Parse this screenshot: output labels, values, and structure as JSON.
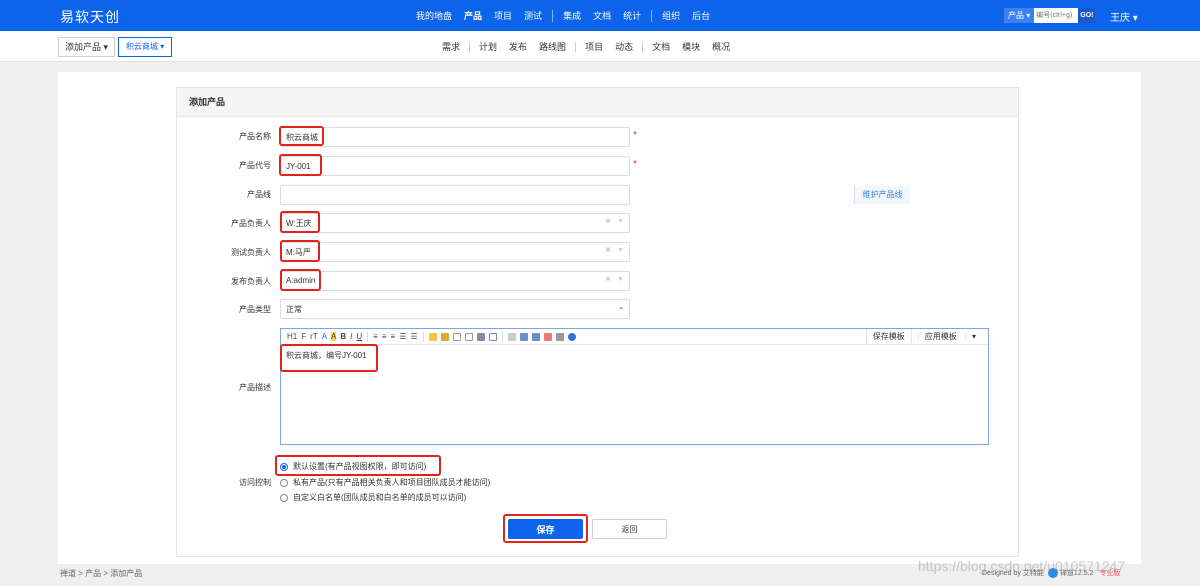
{
  "brand": "易软天创",
  "main_nav": [
    "我的地盘",
    "产品",
    "项目",
    "测试",
    "集成",
    "文档",
    "统计",
    "组织",
    "后台"
  ],
  "search": {
    "scope": "产品",
    "placeholder": "编号(ctrl+g)",
    "go": "GO!"
  },
  "user": "王庆",
  "breadcrumb": {
    "first": "添加产品",
    "second": "积云商城"
  },
  "sub_nav": [
    "需求",
    "计划",
    "发布",
    "路线图",
    "项目",
    "动态",
    "文档",
    "模块",
    "概况"
  ],
  "form": {
    "title": "添加产品",
    "name_label": "产品名称",
    "name_value": "积云商城",
    "code_label": "产品代号",
    "code_value": "JY-001",
    "line_label": "产品线",
    "line_addon": "维护产品线",
    "po_label": "产品负责人",
    "po_value": "W:王庆",
    "qd_label": "测试负责人",
    "qd_value": "M:马严",
    "rd_label": "发布负责人",
    "rd_value": "A:admin",
    "type_label": "产品类型",
    "type_value": "正常",
    "desc_label": "产品描述",
    "desc_value": "积云商城，编号JY-001",
    "acl_label": "访问控制",
    "acl_options": [
      "默认设置(有产品视图权限，即可访问)",
      "私有产品(只有产品相关负责人和项目团队成员才能访问)",
      "自定义白名单(团队成员和白名单的成员可以访问)"
    ],
    "required_mark": "*",
    "save": "保存",
    "back": "返回"
  },
  "editor": {
    "tools": [
      "H1",
      "F",
      "rT",
      "A",
      "A",
      "B",
      "I",
      "U"
    ],
    "save_template": "保存模板",
    "apply_template": "应用模板"
  },
  "footer": {
    "path": "禅道 > 产品 > 添加产品",
    "designed_by": "Designed by 艾特能",
    "version": "禅道12.5.2",
    "edition": "专业版",
    "watermark": "https://blog.csdn.net/u010571247"
  }
}
